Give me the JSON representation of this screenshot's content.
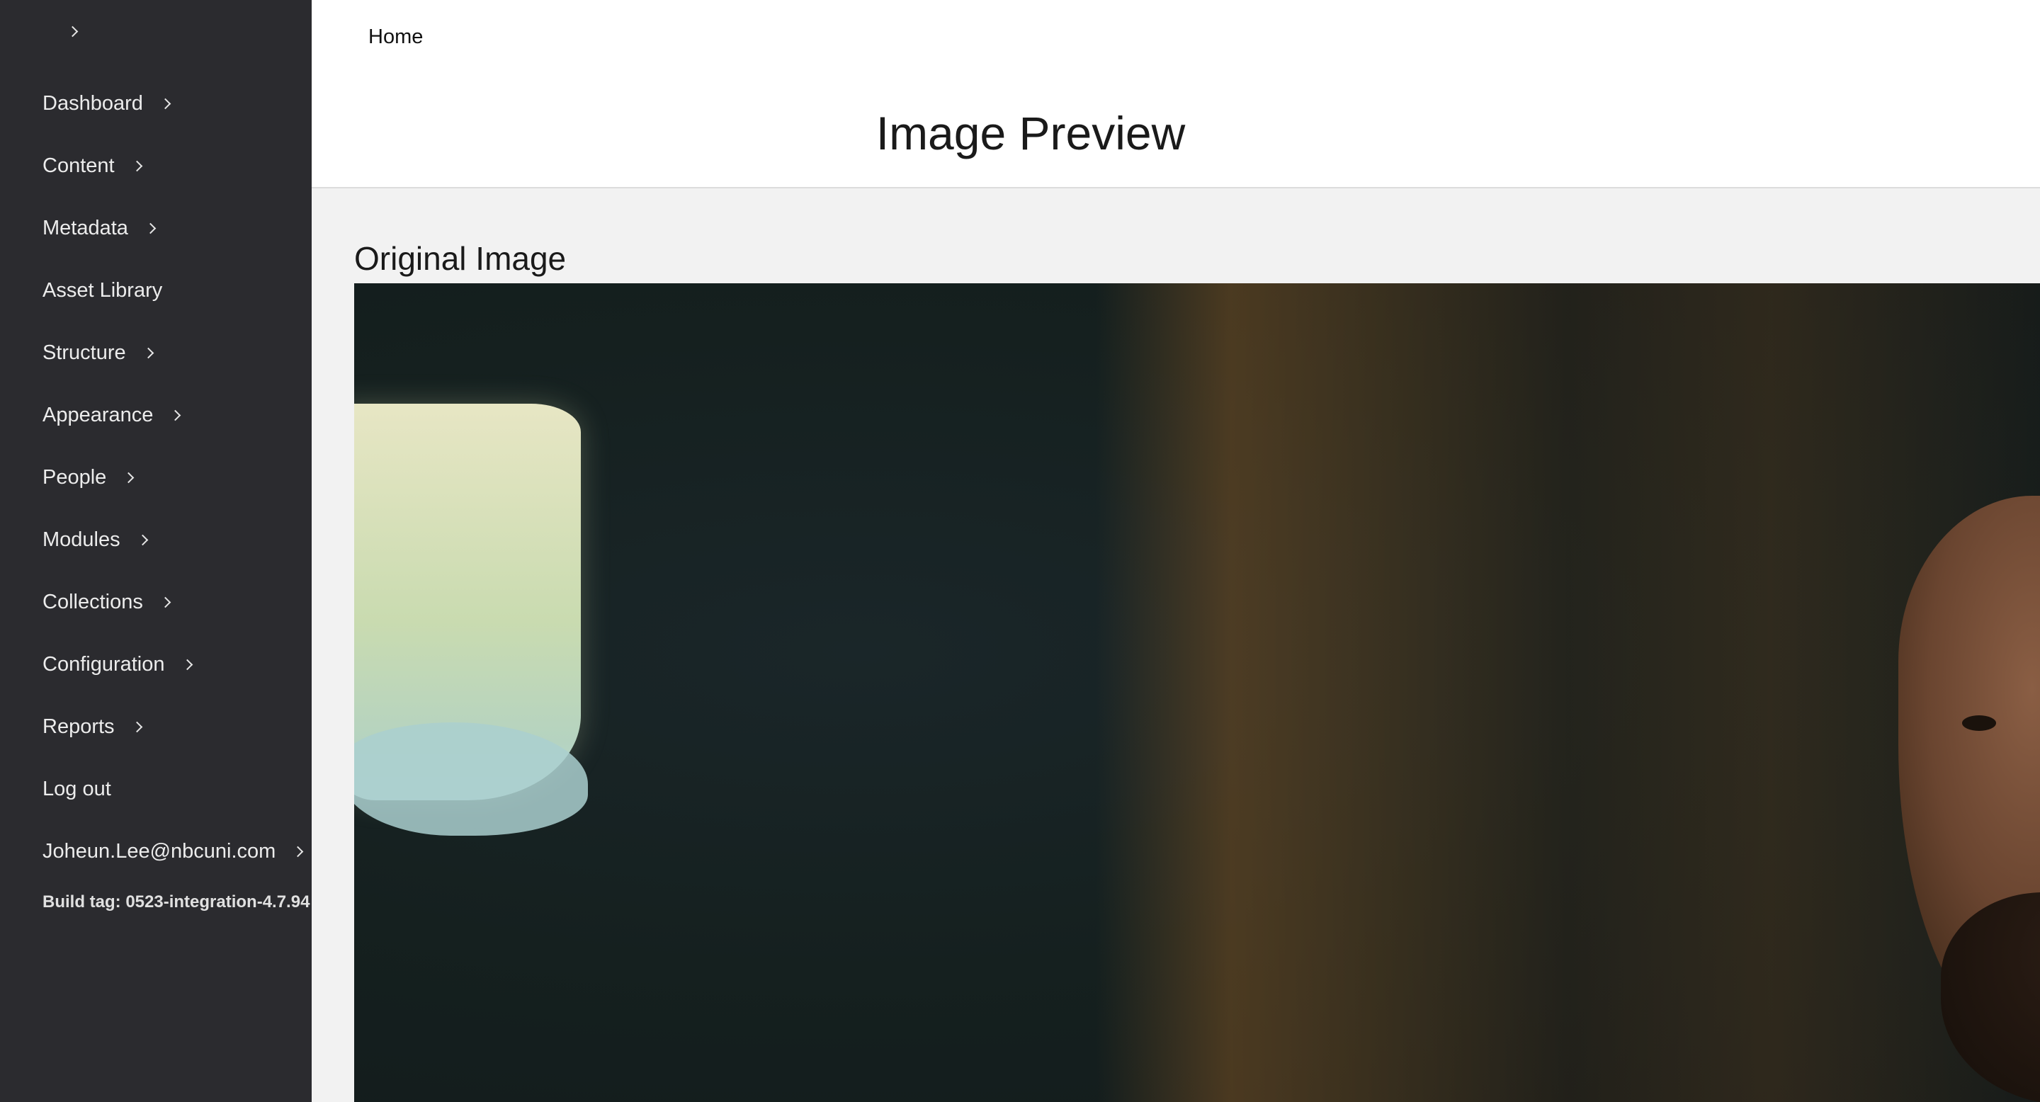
{
  "sidebar": {
    "toggle_icon": "chevron-right-icon",
    "items": [
      {
        "label": "Dashboard",
        "has_submenu": true
      },
      {
        "label": "Content",
        "has_submenu": true
      },
      {
        "label": "Metadata",
        "has_submenu": true
      },
      {
        "label": "Asset Library",
        "has_submenu": false
      },
      {
        "label": "Structure",
        "has_submenu": true
      },
      {
        "label": "Appearance",
        "has_submenu": true
      },
      {
        "label": "People",
        "has_submenu": true
      },
      {
        "label": "Modules",
        "has_submenu": true
      },
      {
        "label": "Collections",
        "has_submenu": true
      },
      {
        "label": "Configuration",
        "has_submenu": true
      },
      {
        "label": "Reports",
        "has_submenu": true
      },
      {
        "label": "Log out",
        "has_submenu": false
      },
      {
        "label": "Joheun.Lee@nbcuni.com",
        "has_submenu": true
      }
    ],
    "build_tag": "Build tag: 0523-integration-4.7.94"
  },
  "header": {
    "breadcrumb": "Home",
    "title": "Image Preview"
  },
  "main": {
    "section_title": "Original Image"
  },
  "colors": {
    "sidebar_bg": "#2b2b2f",
    "header_bg": "#ffffff",
    "content_bg": "#f2f2f2"
  }
}
